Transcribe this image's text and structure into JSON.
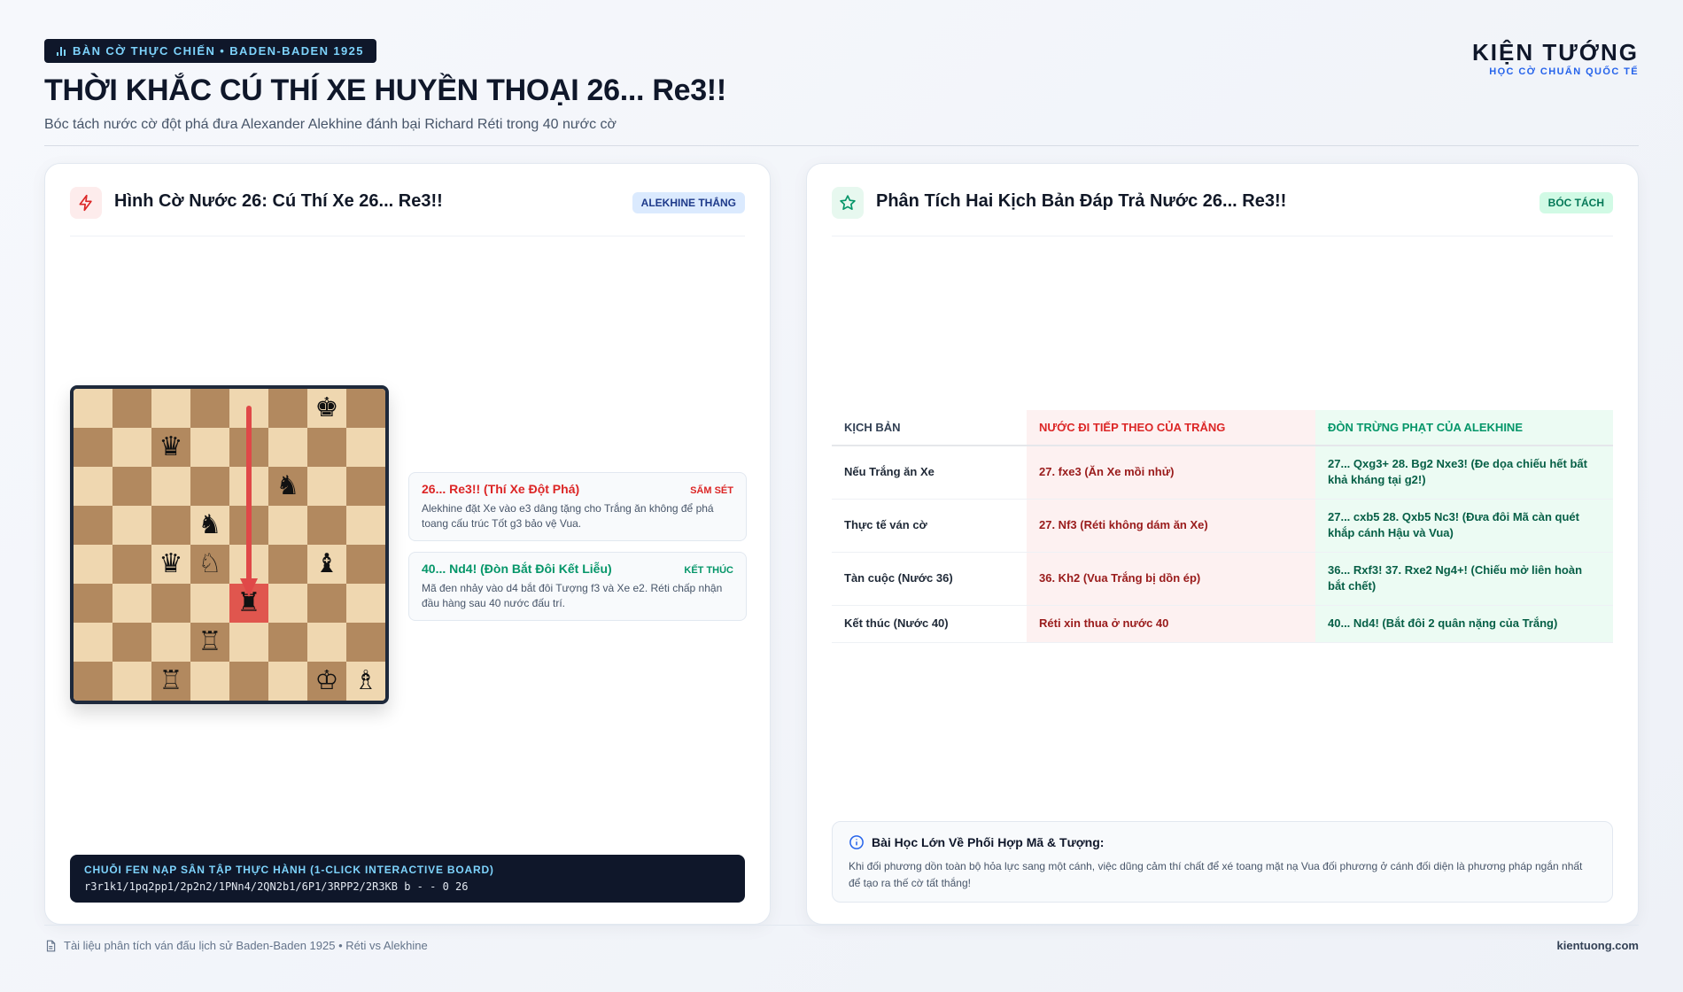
{
  "header": {
    "tag": "BÀN CỜ THỰC CHIẾN • BADEN-BADEN 1925",
    "title": "THỜI KHẮC CÚ THÍ XE HUYỀN THOẠI 26... Re3!!",
    "subtitle": "Bóc tách nước cờ đột phá đưa Alexander Alekhine đánh bại Richard Réti trong 40 nước cờ",
    "brand_name": "KIỆN TƯỚNG",
    "brand_sub": "HỌC CỜ CHUẨN QUỐC TẾ"
  },
  "left_panel": {
    "icon": "lightning-icon",
    "title": "Hình Cờ Nước 26: Cú Thí Xe 26... Re3!!",
    "badge": "ALEKHINE THẮNG",
    "board": {
      "rows": [
        [
          "",
          "",
          "",
          "",
          "",
          "",
          "♚",
          ""
        ],
        [
          "",
          "",
          "♛",
          "",
          "",
          "",
          "",
          ""
        ],
        [
          "",
          "",
          "",
          "",
          "",
          "♞",
          "",
          ""
        ],
        [
          "",
          "",
          "",
          "♞",
          "",
          "",
          "",
          ""
        ],
        [
          "",
          "",
          "♛",
          "♘",
          "",
          "",
          "♝",
          ""
        ],
        [
          "",
          "",
          "",
          "",
          "♜",
          "",
          "",
          ""
        ],
        [
          "",
          "",
          "",
          "♖",
          "",
          "",
          "",
          ""
        ],
        [
          "",
          "",
          "♖",
          "",
          "",
          "",
          "♔",
          "♗"
        ]
      ],
      "highlight": "e3",
      "arrow": {
        "from": "e8",
        "to": "e3"
      }
    },
    "notes": [
      {
        "title": "26... Re3!! (Thí Xe Đột Phá)",
        "tag": "SẤM SÉT",
        "body": "Alekhine đặt Xe vào e3 dâng tặng cho Trắng ăn không để phá toang cấu trúc Tốt g3 bảo vệ Vua."
      },
      {
        "title": "40... Nd4! (Đòn Bắt Đôi Kết Liễu)",
        "tag": "KẾT THÚC",
        "body": "Mã đen nhảy vào d4 bắt đôi Tượng f3 và Xe e2. Réti chấp nhận đầu hàng sau 40 nước đấu trí."
      }
    ],
    "fen_label": "CHUỖI FEN NẠP SÂN TẬP THỰC HÀNH (1-CLICK INTERACTIVE BOARD)",
    "fen_value": "r3r1k1/1pq2pp1/2p2n2/1PNn4/2QN2b1/6P1/3RPP2/2R3KB b - - 0 26"
  },
  "right_panel": {
    "icon": "star-icon",
    "title": "Phân Tích Hai Kịch Bản Đáp Trả Nước 26... Re3!!",
    "badge": "BÓC TÁCH",
    "columns": [
      "KỊCH BẢN",
      "NƯỚC ĐI TIẾP THEO CỦA TRẮNG",
      "ĐÒN TRỪNG PHẠT CỦA ALEKHINE"
    ],
    "rows": [
      [
        "Nếu Trắng ăn Xe",
        "27. fxe3 (Ăn Xe mồi nhử)",
        "27... Qxg3+ 28. Bg2 Nxe3! (Đe dọa chiếu hết bất khả kháng tại g2!)"
      ],
      [
        "Thực tế ván cờ",
        "27. Nf3 (Réti không dám ăn Xe)",
        "27... cxb5 28. Qxb5 Nc3! (Đưa đôi Mã càn quét khắp cánh Hậu và Vua)"
      ],
      [
        "Tàn cuộc (Nước 36)",
        "36. Kh2 (Vua Trắng bị dồn ép)",
        "36... Rxf3! 37. Rxe2 Ng4+! (Chiếu mở liên hoàn bắt chết)"
      ],
      [
        "Kết thúc (Nước 40)",
        "Réti xin thua ở nước 40",
        "40... Nd4! (Bắt đôi 2 quân nặng của Trắng)"
      ]
    ],
    "lesson_title": "Bài Học Lớn Về Phối Hợp Mã & Tượng:",
    "lesson_body": "Khi đối phương dồn toàn bộ hỏa lực sang một cánh, việc dũng cảm thí chất để xé toang mặt nạ Vua đối phương ở cánh đối diện là phương pháp ngắn nhất để tạo ra thế cờ tất thắng!"
  },
  "footer": {
    "left": "Tài liệu phân tích ván đấu lịch sử Baden-Baden 1925 • Réti vs Alekhine",
    "right": "kientuong.com"
  },
  "colors": {
    "accent_red": "#dc2626",
    "accent_green": "#059669",
    "accent_blue": "#2563eb",
    "dark": "#0f172a",
    "board_light": "#efd7b0",
    "board_dark": "#b2895f",
    "highlight": "#e0564e"
  }
}
